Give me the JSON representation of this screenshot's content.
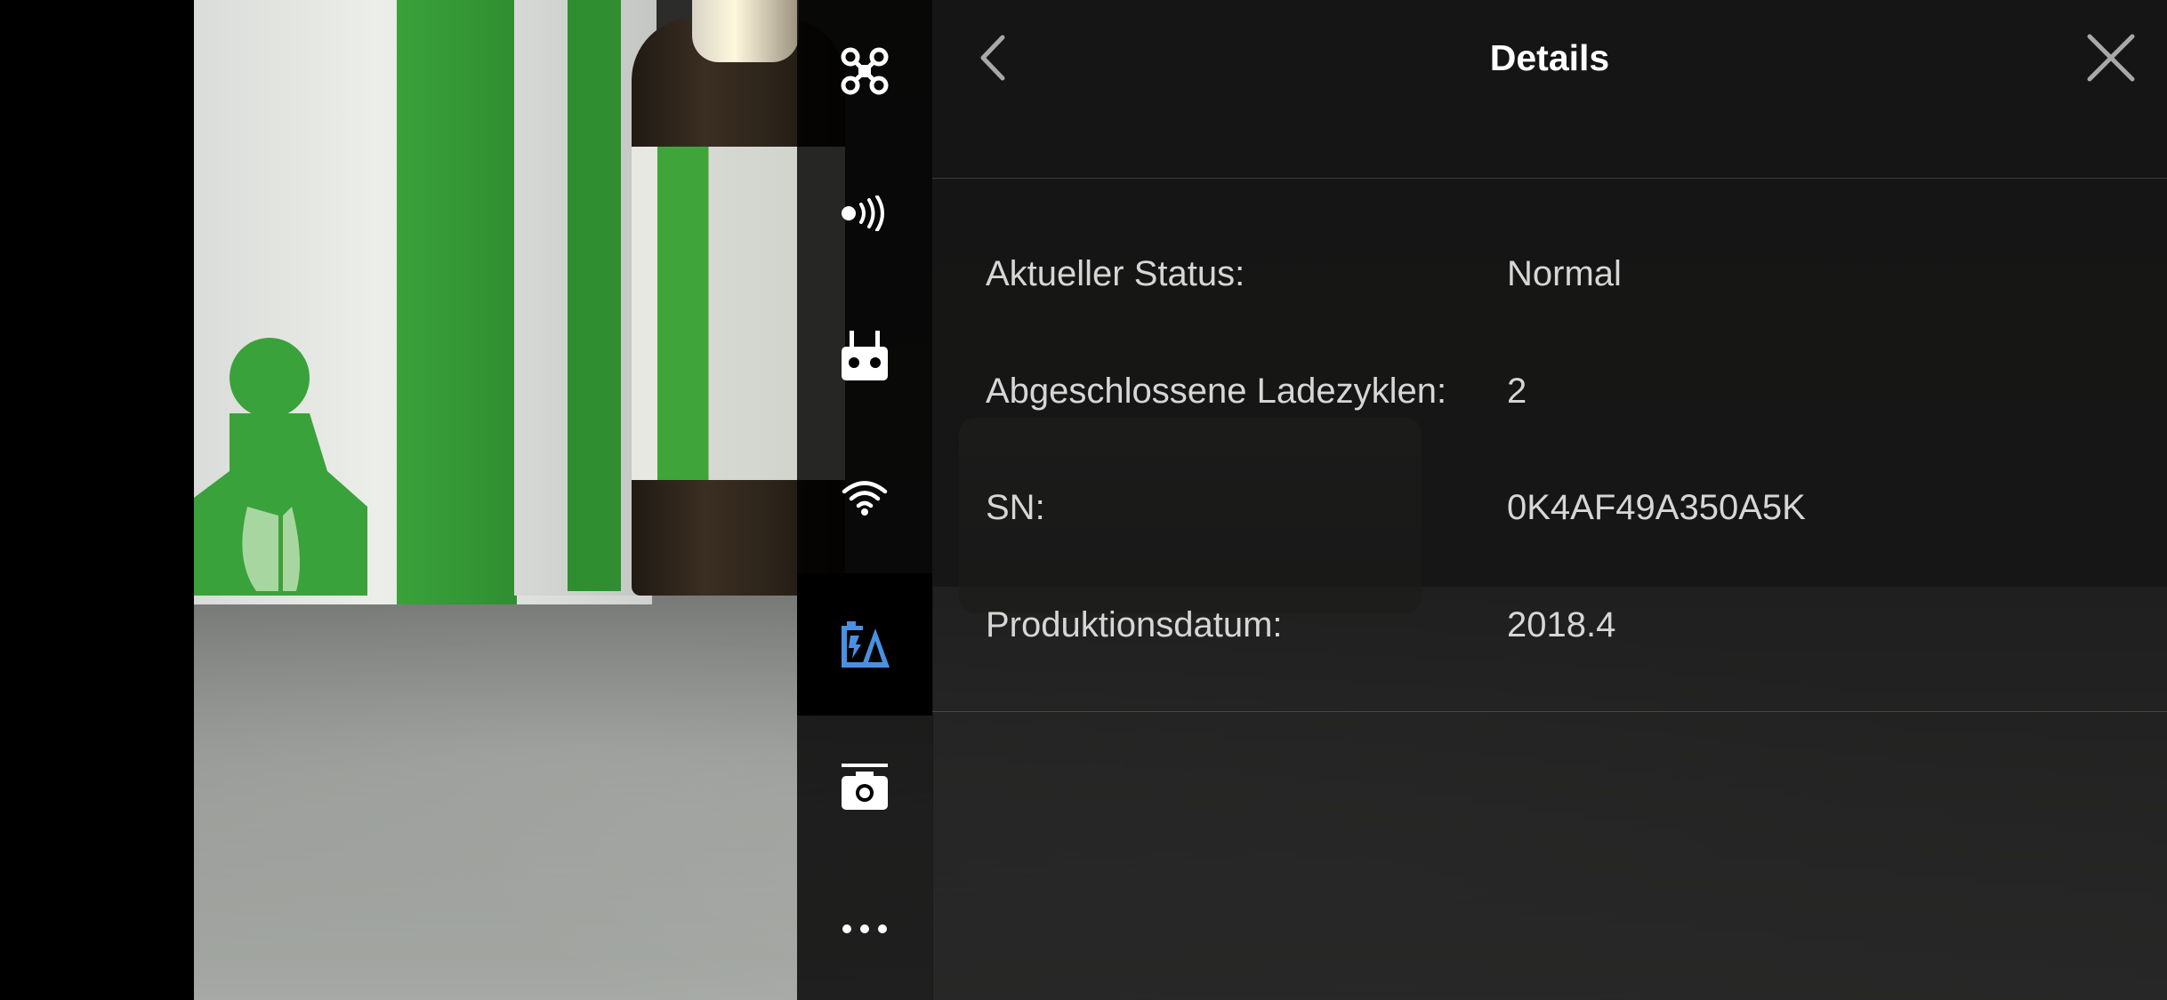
{
  "header": {
    "title": "Details"
  },
  "sidebar": {
    "items": [
      {
        "icon": "aircraft-icon",
        "active": false
      },
      {
        "icon": "signal-transmission-icon",
        "active": false
      },
      {
        "icon": "remote-controller-icon",
        "active": false
      },
      {
        "icon": "wifi-icon",
        "active": false
      },
      {
        "icon": "battery-icon",
        "active": true
      },
      {
        "icon": "camera-icon",
        "active": false
      },
      {
        "icon": "more-icon",
        "active": false
      }
    ],
    "active_color": "#4a90e2",
    "icon_color": "#ffffff"
  },
  "details": {
    "rows": [
      {
        "label": "Aktueller Status:",
        "value": "Normal"
      },
      {
        "label": "Abgeschlossene Ladezyklen:",
        "value": "2"
      },
      {
        "label": "SN:",
        "value": "0K4AF49A350A5K"
      },
      {
        "label": "Produktionsdatum:",
        "value": "2018.4"
      }
    ]
  }
}
